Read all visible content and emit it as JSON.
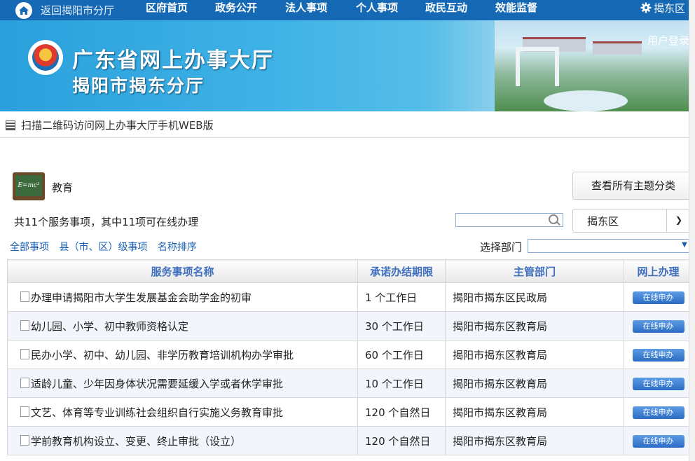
{
  "topnav": {
    "back_label": "返回揭阳市分厅",
    "items": [
      "区府首页",
      "政务公开",
      "法人事项",
      "个人事项",
      "政民互动",
      "效能监督"
    ],
    "district": "揭东区"
  },
  "banner": {
    "title_line1": "广东省网上办事大厅",
    "title_line2": "揭阳市揭东分厅",
    "login": "用户登录"
  },
  "qr_text": "扫描二维码访问网上办事大厅手机WEB版",
  "topic": {
    "name": "教育",
    "board_text": "E=mc²",
    "all_topics_button": "查看所有主题分类"
  },
  "summary": "共11个服务事项，其中11项可在线办理",
  "search": {
    "placeholder": ""
  },
  "district_select": "揭东区",
  "filters": [
    "全部事项",
    "县（市、区）级事项",
    "名称排序"
  ],
  "dept_label": "选择部门",
  "table": {
    "headers": [
      "服务事项名称",
      "承诺办结期限",
      "主管部门",
      "网上办理"
    ],
    "button_label": "在线申办",
    "rows": [
      [
        "办理申请揭阳市大学生发展基金会助学金的初审",
        "1 个工作日",
        "揭阳市揭东区民政局"
      ],
      [
        "幼儿园、小学、初中教师资格认定",
        "30 个工作日",
        "揭阳市揭东区教育局"
      ],
      [
        "民办小学、初中、幼儿园、非学历教育培训机构办学审批",
        "60 个工作日",
        "揭阳市揭东区教育局"
      ],
      [
        "适龄儿童、少年因身体状况需要延缓入学或者休学审批",
        "10 个工作日",
        "揭阳市揭东区教育局"
      ],
      [
        "文艺、体育等专业训练社会组织自行实施义务教育审批",
        "120 个自然日",
        "揭阳市揭东区教育局"
      ],
      [
        "学前教育机构设立、变更、终止审批（设立）",
        "120 个自然日",
        "揭阳市揭东区教育局"
      ]
    ]
  },
  "colors": {
    "nav": "#1468b4",
    "header_text": "#3f6fbf",
    "link": "#1a5fb4",
    "button": "#2a6cc4"
  }
}
